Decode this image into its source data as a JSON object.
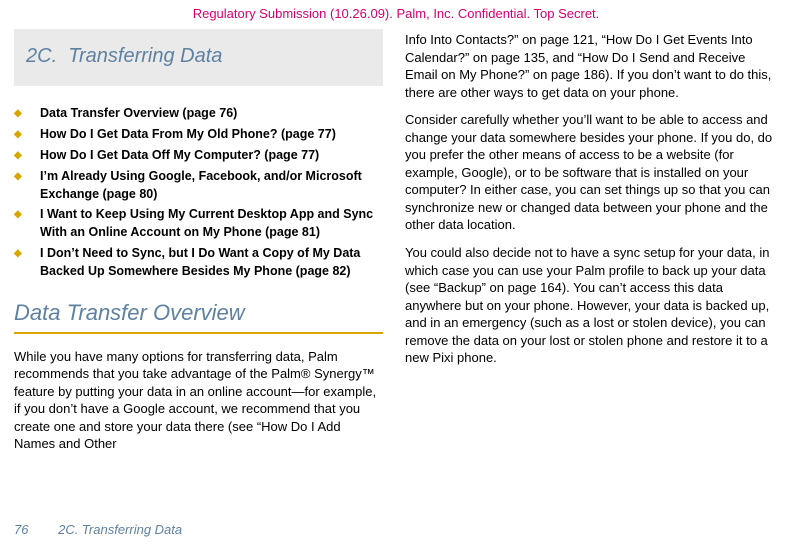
{
  "banner": "Regulatory Submission (10.26.09). Palm, Inc. Confidential. Top Secret.",
  "chapter": {
    "label": "2C.",
    "title": "Transferring Data"
  },
  "toc": [
    {
      "label": "Data Transfer Overview  (page 76)"
    },
    {
      "label": "How Do I Get Data From My Old Phone?  (page 77)"
    },
    {
      "label": "How Do I Get Data Off My Computer?  (page 77)"
    },
    {
      "label": "I’m Already Using Google, Facebook, and/or Microsoft Exchange  (page 80)"
    },
    {
      "label": "I Want to Keep Using My Current Desktop App and Sync With an Online Account on My Phone  (page 81)"
    },
    {
      "label": "I Don’t Need to Sync, but I Do Want a Copy of My Data Backed Up Somewhere Besides My Phone  (page 82)"
    }
  ],
  "section_title": "Data Transfer Overview",
  "para_left": "While you have many options for transferring data, Palm recommends that you take advantage of the Palm® Synergy™ feature by putting your data in an online account—for example, if you don’t have a Google account, we recommend that you create one and store your data there (see “How Do I Add Names and Other",
  "para_r1": "Info Into Contacts?” on page 121, “How Do I Get Events Into Calendar?” on page 135, and “How Do I Send and Receive Email on My Phone?” on page 186). If you don’t want to do this, there are other ways to get data on your phone.",
  "para_r2": "Consider carefully whether you’ll want to be able to access and change your data somewhere besides your phone. If you do, do you prefer the other means of access to be a website (for example, Google), or to be software that is installed on your computer? In either case, you can set things up so that you can synchronize new or changed data between your phone and the other data location.",
  "para_r3": "You could also decide not to have a sync setup for your data, in which case you can use your Palm profile to back up your data (see “Backup” on page 164). You can’t access this data anywhere but on your phone. However, your data is backed up, and in an emergency (such as a lost or stolen device), you can remove the data on your lost or stolen phone and restore it to a new Pixi phone.",
  "footer": {
    "page_number": "76",
    "running_head": "2C. Transferring Data"
  }
}
